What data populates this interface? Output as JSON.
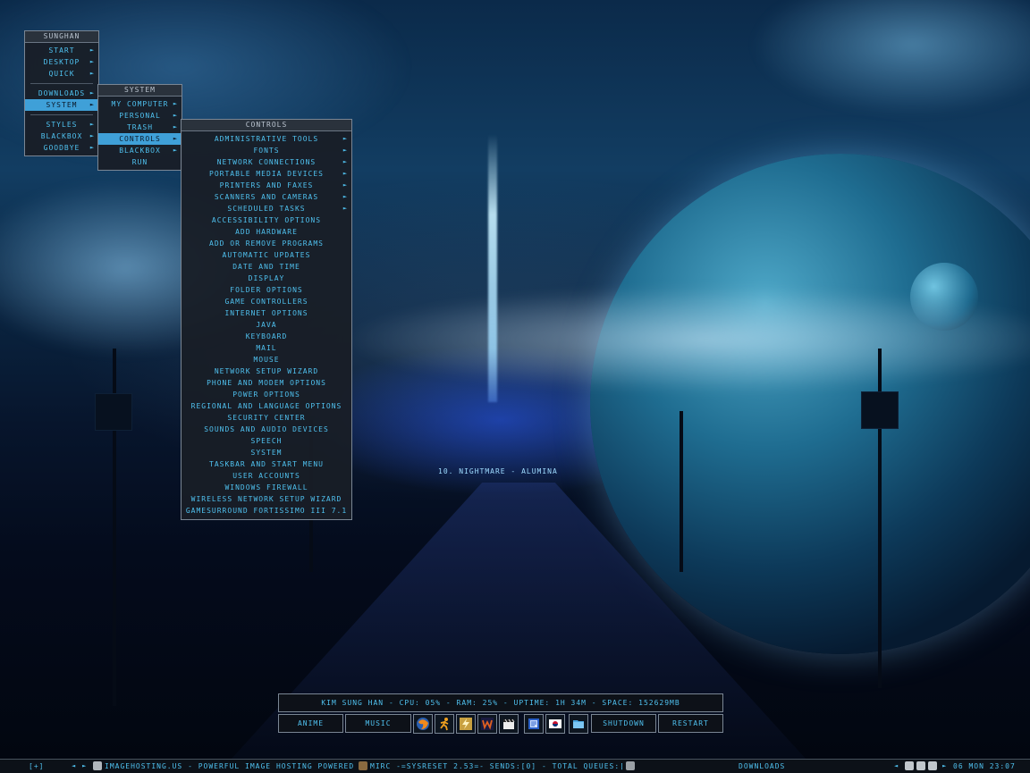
{
  "desktop_menu": {
    "title": "Sunghan",
    "items": [
      {
        "label": "Start",
        "submenu": true
      },
      {
        "label": "Desktop",
        "submenu": true
      },
      {
        "label": "Quick",
        "submenu": true
      },
      {
        "label": "Downloads",
        "submenu": true
      },
      {
        "label": "System",
        "submenu": true,
        "active": true
      },
      {
        "label": "Styles",
        "submenu": true
      },
      {
        "label": "Blackbox",
        "submenu": true
      },
      {
        "label": "Goodbye",
        "submenu": true
      }
    ]
  },
  "system_menu": {
    "title": "System",
    "items": [
      {
        "label": "My Computer",
        "submenu": true
      },
      {
        "label": "Personal",
        "submenu": true
      },
      {
        "label": "Trash",
        "submenu": true
      },
      {
        "label": "Controls",
        "submenu": true,
        "active": true
      },
      {
        "label": "Blackbox",
        "submenu": true
      },
      {
        "label": "Run",
        "submenu": false
      }
    ]
  },
  "controls_menu": {
    "title": "Controls",
    "items": [
      {
        "label": "Administrative Tools",
        "submenu": true
      },
      {
        "label": "Fonts",
        "submenu": true
      },
      {
        "label": "Network Connections",
        "submenu": true
      },
      {
        "label": "Portable Media Devices",
        "submenu": true
      },
      {
        "label": "Printers and Faxes",
        "submenu": true
      },
      {
        "label": "Scanners and Cameras",
        "submenu": true
      },
      {
        "label": "Scheduled Tasks",
        "submenu": true
      },
      {
        "label": "Accessibility Options",
        "submenu": false
      },
      {
        "label": "Add Hardware",
        "submenu": false
      },
      {
        "label": "Add or Remove Programs",
        "submenu": false
      },
      {
        "label": "Automatic Updates",
        "submenu": false
      },
      {
        "label": "Date and Time",
        "submenu": false
      },
      {
        "label": "Display",
        "submenu": false
      },
      {
        "label": "Folder Options",
        "submenu": false
      },
      {
        "label": "Game Controllers",
        "submenu": false
      },
      {
        "label": "Internet Options",
        "submenu": false
      },
      {
        "label": "Java",
        "submenu": false
      },
      {
        "label": "Keyboard",
        "submenu": false
      },
      {
        "label": "Mail",
        "submenu": false
      },
      {
        "label": "Mouse",
        "submenu": false
      },
      {
        "label": "Network Setup Wizard",
        "submenu": false
      },
      {
        "label": "Phone and Modem Options",
        "submenu": false
      },
      {
        "label": "Power Options",
        "submenu": false
      },
      {
        "label": "Regional and Language Options",
        "submenu": false
      },
      {
        "label": "Security Center",
        "submenu": false
      },
      {
        "label": "Sounds and Audio Devices",
        "submenu": false
      },
      {
        "label": "Speech",
        "submenu": false
      },
      {
        "label": "System",
        "submenu": false
      },
      {
        "label": "Taskbar and Start Menu",
        "submenu": false
      },
      {
        "label": "User Accounts",
        "submenu": false
      },
      {
        "label": "Windows Firewall",
        "submenu": false
      },
      {
        "label": "Wireless Network Setup Wizard",
        "submenu": false
      },
      {
        "label": "GameSurround Fortissimo III 7.1",
        "submenu": false
      }
    ]
  },
  "now_playing": "10. Nightmare - Alumina",
  "stats": "Kim Sung Han - CPU: 05% - RAM: 25% - Uptime: 1h 34m - Space: 152629mb",
  "launcher": {
    "buttons": [
      "Anime",
      "Music",
      "Shutdown",
      "Restart"
    ],
    "icons": [
      "firefox-icon",
      "runner-icon",
      "lightning-icon",
      "winamp-icon",
      "clapperboard-icon",
      "notepad-icon",
      "korea-flag-icon",
      "folder-icon"
    ]
  },
  "taskbar": {
    "menu_button": "[+]",
    "prev_arrow": "◄",
    "next_arrow": "►",
    "tasks": [
      "imagehosting.us - Powerful Image Hosting Powered ...",
      "mIRC -=SysReset 2.53=- Sends:[0] - Total Queues:[0..."
    ],
    "workspace": "Downloads",
    "clock": "06 Mon 23:07",
    "colors": {
      "accent": "#4fc0ee",
      "menu_bg": "#181e26",
      "active_bg": "#3fa0d8"
    }
  }
}
